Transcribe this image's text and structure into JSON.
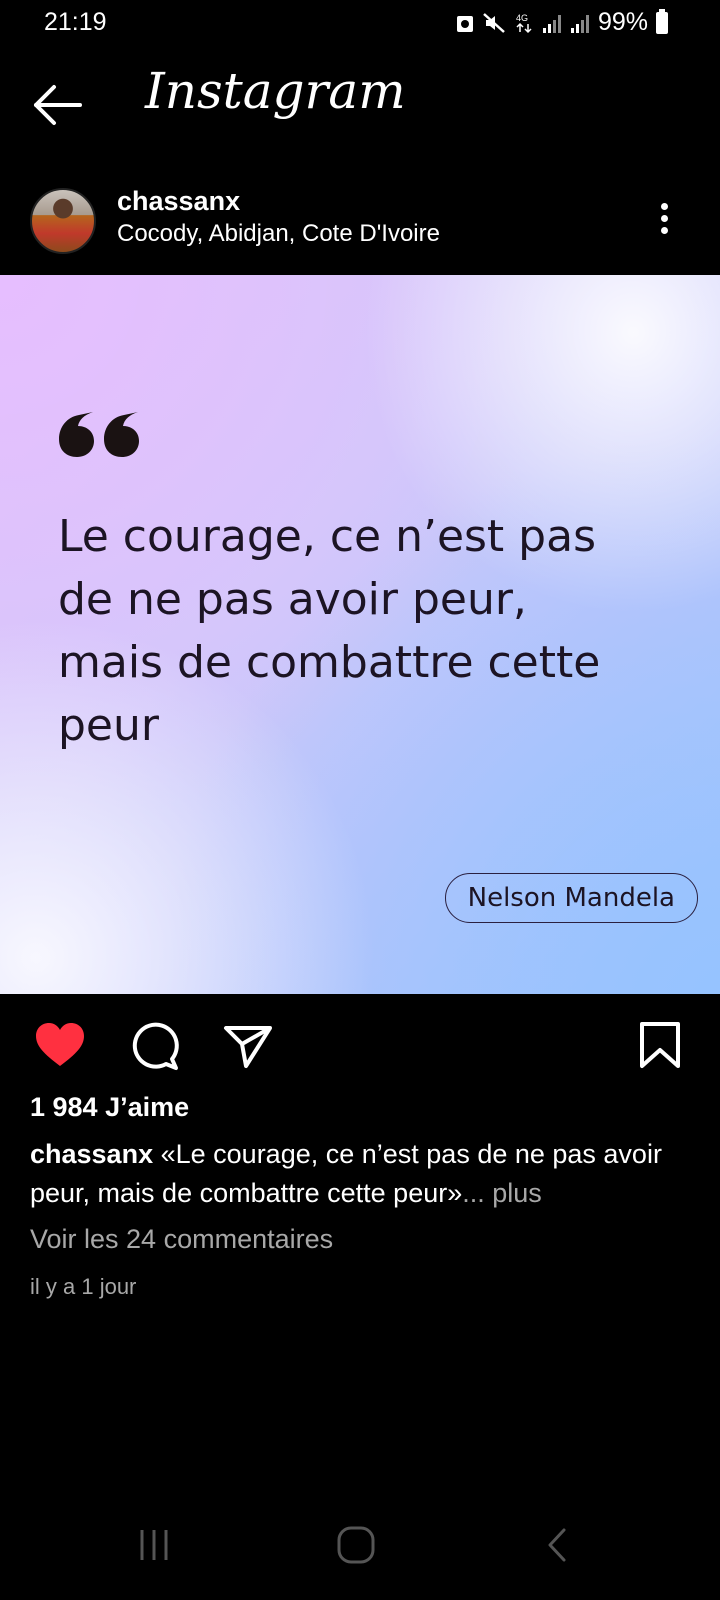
{
  "status_bar": {
    "time": "21:19",
    "battery": "99%",
    "network": "4G"
  },
  "header": {
    "title": "Instagram",
    "back_icon": "arrow-left-icon"
  },
  "post": {
    "username": "chassanx",
    "location": "Cocody, Abidjan, Cote D'Ivoire",
    "image": {
      "quote": "Le courage, ce n’est pas de ne pas avoir peur, mais de combattre cette peur",
      "quote_lines": [
        "Le courage, ce n’est pas",
        "de ne pas avoir peur,",
        "mais de combattre cette",
        "peur"
      ],
      "author": "Nelson Mandela",
      "gradient_colors": [
        "#dcc6f8",
        "#cfc9fa",
        "#b9c4fb",
        "#a2c4fb"
      ]
    },
    "likes": "1 984 J’aime",
    "caption_user": "chassanx",
    "caption_text": "«Le courage, ce n’est pas de ne pas avoir peur, mais de combattre cette peur»",
    "caption_more": "... plus",
    "comments_link": "Voir les 24 commentaires",
    "timestamp": "il y a 1 jour",
    "like_color": "#ff3040"
  },
  "icons": {
    "like": "heart-icon",
    "comment": "comment-icon",
    "share": "send-icon",
    "save": "bookmark-icon",
    "more": "more-vertical-icon"
  }
}
